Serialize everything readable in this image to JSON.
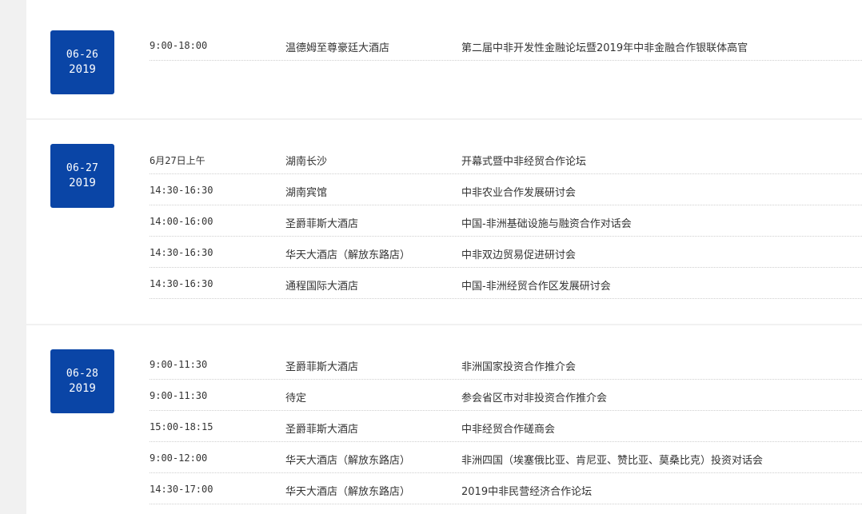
{
  "days": [
    {
      "month_day": "06-26",
      "year": "2019",
      "events": [
        {
          "time": "9:00-18:00",
          "venue": "温德姆至尊豪廷大酒店",
          "title": "第二届中非开发性金融论坛暨2019年中非金融合作银联体高官"
        }
      ]
    },
    {
      "month_day": "06-27",
      "year": "2019",
      "events": [
        {
          "time": "6月27日上午",
          "venue": "湖南长沙",
          "title": "开幕式暨中非经贸合作论坛"
        },
        {
          "time": "14:30-16:30",
          "venue": "湖南宾馆",
          "title": "中非农业合作发展研讨会"
        },
        {
          "time": "14:00-16:00",
          "venue": "圣爵菲斯大酒店",
          "title": "中国-非洲基础设施与融资合作对话会"
        },
        {
          "time": "14:30-16:30",
          "venue": "华天大酒店（解放东路店）",
          "title": "中非双边贸易促进研讨会"
        },
        {
          "time": "14:30-16:30",
          "venue": "通程国际大酒店",
          "title": "中国-非洲经贸合作区发展研讨会"
        }
      ]
    },
    {
      "month_day": "06-28",
      "year": "2019",
      "events": [
        {
          "time": "9:00-11:30",
          "venue": "圣爵菲斯大酒店",
          "title": "非洲国家投资合作推介会"
        },
        {
          "time": "9:00-11:30",
          "venue": "待定",
          "title": "参会省区市对非投资合作推介会"
        },
        {
          "time": "15:00-18:15",
          "venue": "圣爵菲斯大酒店",
          "title": "中非经贸合作磋商会"
        },
        {
          "time": "9:00-12:00",
          "venue": "华天大酒店（解放东路店）",
          "title": "非洲四国（埃塞俄比亚、肯尼亚、赞比亚、莫桑比克）投资对话会"
        },
        {
          "time": "14:30-17:00",
          "venue": "华天大酒店（解放东路店）",
          "title": "2019中非民营经济合作论坛"
        }
      ]
    }
  ],
  "colors": {
    "badge_bg": "#0a45a6",
    "page_bg": "#f1f1f1",
    "card_bg": "#ffffff"
  }
}
